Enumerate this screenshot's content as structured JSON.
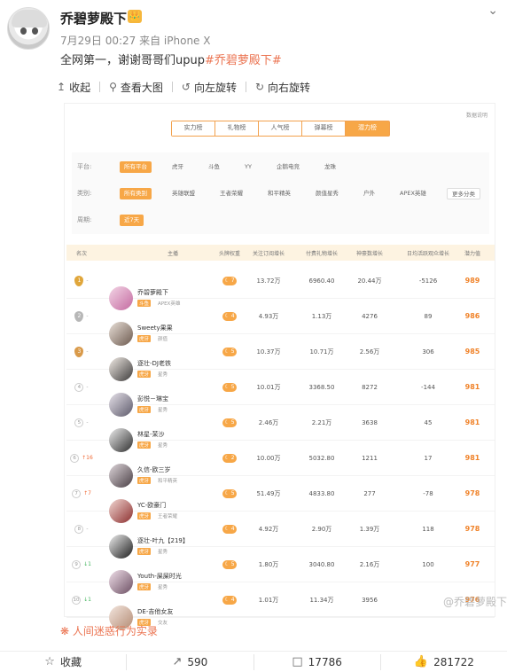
{
  "post": {
    "user_name": "乔碧萝殿下",
    "crown_icon": "👑",
    "meta": "7月29日 00:27 来自 iPhone X",
    "text": "全网第一，谢谢哥哥们upup",
    "topic": "#乔碧萝殿下#"
  },
  "toolbar": {
    "collapse": "收起",
    "view_large": "查看大图",
    "rotate_left": "向左旋转",
    "rotate_right": "向右旋转"
  },
  "board": {
    "tabs": [
      "实力榜",
      "礼物榜",
      "人气榜",
      "弹幕榜",
      "潜力榜"
    ],
    "active_tab_index": 4,
    "data_note": "数据说明",
    "filters": {
      "platform_label": "平台:",
      "platforms": [
        "所有平台",
        "虎牙",
        "斗鱼",
        "YY",
        "企鹅电竞",
        "龙珠"
      ],
      "category_label": "类别:",
      "categories": [
        "所有类别",
        "英雄联盟",
        "王者荣耀",
        "和平精英",
        "颜值星秀",
        "户外",
        "APEX英雄",
        "更多分类"
      ],
      "period_label": "周期:",
      "period": "近7天"
    },
    "columns": [
      "名次",
      "主播",
      "头牌权重",
      "关注订阅增长",
      "付费礼物增长",
      "神豪数增长",
      "日均活跃观众增长",
      "潜力值"
    ],
    "rows": [
      {
        "rank": "1",
        "medal": "gold",
        "trend": "-",
        "trend_dir": "flat",
        "name": "乔碧萝殿下",
        "platform": "斗鱼",
        "category": "APEX英雄",
        "level": "7",
        "fans": "13.72万",
        "gift": "6960.40",
        "god": "20.44万",
        "danmu": "-5126",
        "power": "989"
      },
      {
        "rank": "2",
        "medal": "silver",
        "trend": "-",
        "trend_dir": "flat",
        "name": "Sweety果果",
        "platform": "虎牙",
        "category": "颜值",
        "level": "4",
        "fans": "4.93万",
        "gift": "1.13万",
        "god": "4276",
        "danmu": "89",
        "power": "986"
      },
      {
        "rank": "3",
        "medal": "bronze",
        "trend": "-",
        "trend_dir": "flat",
        "name": "逐壮-DJ老铁",
        "platform": "虎牙",
        "category": "星秀",
        "level": "5",
        "fans": "10.37万",
        "gift": "10.71万",
        "god": "2.56万",
        "danmu": "306",
        "power": "985"
      },
      {
        "rank": "4",
        "medal": "",
        "trend": "-",
        "trend_dir": "flat",
        "name": "彭悦－琳宝",
        "platform": "虎牙",
        "category": "星秀",
        "level": "5",
        "fans": "10.01万",
        "gift": "3368.50",
        "god": "8272",
        "danmu": "-144",
        "power": "981"
      },
      {
        "rank": "5",
        "medal": "",
        "trend": "-",
        "trend_dir": "flat",
        "name": "林星-茉沙",
        "platform": "虎牙",
        "category": "星秀",
        "level": "5",
        "fans": "2.46万",
        "gift": "2.21万",
        "god": "3638",
        "danmu": "45",
        "power": "981"
      },
      {
        "rank": "6",
        "medal": "",
        "trend": "↑16",
        "trend_dir": "up",
        "name": "久信-欧三岁",
        "platform": "虎牙",
        "category": "和平精英",
        "level": "2",
        "fans": "10.00万",
        "gift": "5032.80",
        "god": "1211",
        "danmu": "17",
        "power": "981"
      },
      {
        "rank": "7",
        "medal": "",
        "trend": "↑7",
        "trend_dir": "up",
        "name": "YC-欧豪门",
        "platform": "虎牙",
        "category": "王者荣耀",
        "level": "5",
        "fans": "51.49万",
        "gift": "4833.80",
        "god": "277",
        "danmu": "-78",
        "power": "978"
      },
      {
        "rank": "8",
        "medal": "",
        "trend": "-",
        "trend_dir": "flat",
        "name": "逐壮-叶九【219】",
        "platform": "虎牙",
        "category": "星秀",
        "level": "4",
        "fans": "4.92万",
        "gift": "2.90万",
        "god": "1.39万",
        "danmu": "118",
        "power": "978"
      },
      {
        "rank": "9",
        "medal": "",
        "trend": "↓1",
        "trend_dir": "down",
        "name": "Youth-屎屎时光",
        "platform": "虎牙",
        "category": "星秀",
        "level": "5",
        "fans": "1.80万",
        "gift": "3040.80",
        "god": "2.16万",
        "danmu": "100",
        "power": "977"
      },
      {
        "rank": "10",
        "medal": "",
        "trend": "↓1",
        "trend_dir": "down",
        "name": "DE-吉他女友",
        "platform": "虎牙",
        "category": "交友",
        "level": "4",
        "fans": "1.01万",
        "gift": "11.34万",
        "god": "3956",
        "danmu": "",
        "power": "976"
      }
    ]
  },
  "watermark": "@乔碧萝殿下",
  "report": "人间迷惑行为实录",
  "actions": {
    "favorite": "收藏",
    "repost": "590",
    "comment": "17786",
    "like": "281722"
  }
}
